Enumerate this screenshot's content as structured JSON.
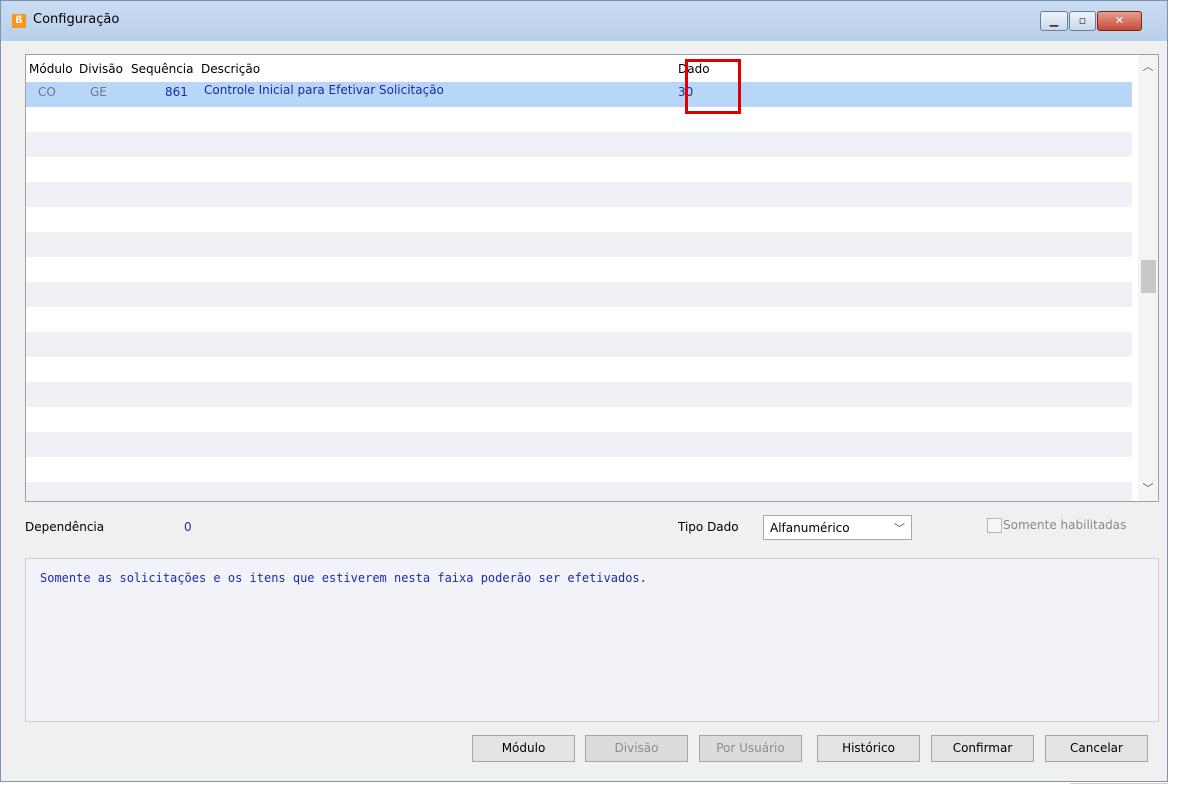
{
  "window": {
    "title": "Configuração",
    "icon": "app-logo-icon",
    "controls": [
      "minimize-icon",
      "maximize-icon",
      "close-icon"
    ]
  },
  "grid": {
    "columns": [
      "Módulo",
      "Divisão",
      "Sequência",
      "Descrição",
      "Dado"
    ],
    "rows": [
      {
        "modulo": "CO",
        "divisao": "GE",
        "sequencia": "861",
        "descricao": "Controle Inicial para Efetivar Solicitação",
        "dado": "30"
      }
    ]
  },
  "dependencia": {
    "label": "Dependência",
    "value": "0"
  },
  "tipo_dado": {
    "label": "Tipo Dado",
    "selected": "Alfanumérico"
  },
  "somente_habilitadas": {
    "label": "Somente habilitadas",
    "checked": false
  },
  "memo": "Somente as solicitações e os itens que estiverem nesta faixa poderão ser efetivados.",
  "buttons": {
    "modulo": "Módulo",
    "divisao": "Divisão",
    "por_usuario": "Por Usuário",
    "historico": "Histórico",
    "confirmar": "Confirmar",
    "cancelar": "Cancelar"
  },
  "colors": {
    "highlight": "#e00000",
    "selection": "#b7d6f8",
    "value_text": "#1a2da8"
  }
}
